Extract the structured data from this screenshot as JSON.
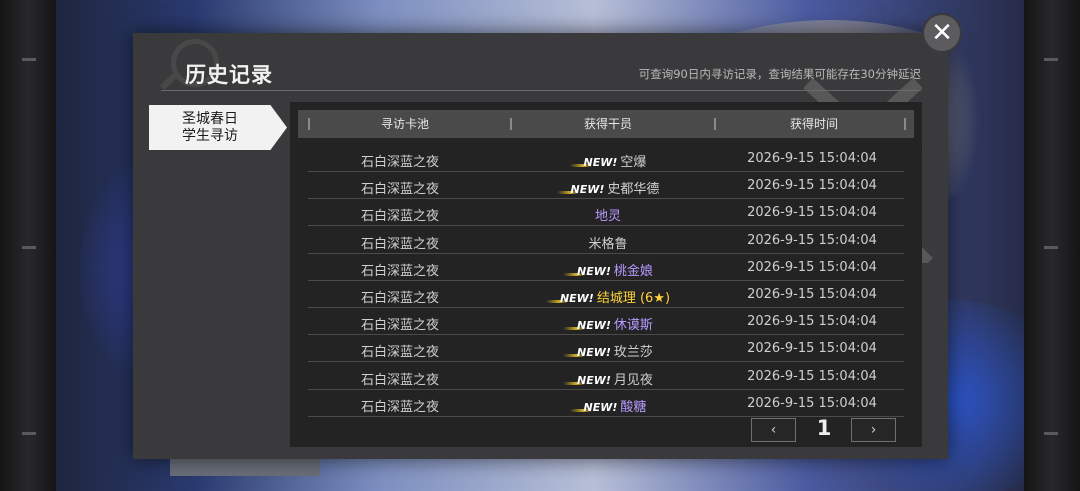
{
  "dialog": {
    "title": "历史记录",
    "notice": "可查询90日内寻访记录，查询结果可能存在30分钟延迟"
  },
  "pool_tab": {
    "line1": "圣城春日",
    "line2": "学生寻访"
  },
  "table": {
    "headers": [
      "寻访卡池",
      "获得干员",
      "获得时间"
    ],
    "rows": [
      {
        "pool": "石白深蓝之夜",
        "new": "NEW!",
        "operator": "空爆",
        "rarity": "gray",
        "time": "2026-9-15 15:04:04"
      },
      {
        "pool": "石白深蓝之夜",
        "new": "NEW!",
        "operator": "史都华德",
        "rarity": "gray",
        "time": "2026-9-15 15:04:04"
      },
      {
        "pool": "石白深蓝之夜",
        "new": "",
        "operator": "地灵",
        "rarity": "purple",
        "time": "2026-9-15 15:04:04"
      },
      {
        "pool": "石白深蓝之夜",
        "new": "",
        "operator": "米格鲁",
        "rarity": "gray",
        "time": "2026-9-15 15:04:04"
      },
      {
        "pool": "石白深蓝之夜",
        "new": "NEW!",
        "operator": "桃金娘",
        "rarity": "purple",
        "time": "2026-9-15 15:04:04"
      },
      {
        "pool": "石白深蓝之夜",
        "new": "NEW!",
        "operator": "结城理 (6★)",
        "rarity": "gold",
        "time": "2026-9-15 15:04:04"
      },
      {
        "pool": "石白深蓝之夜",
        "new": "NEW!",
        "operator": "休谟斯",
        "rarity": "purple",
        "time": "2026-9-15 15:04:04"
      },
      {
        "pool": "石白深蓝之夜",
        "new": "NEW!",
        "operator": "玫兰莎",
        "rarity": "gray",
        "time": "2026-9-15 15:04:04"
      },
      {
        "pool": "石白深蓝之夜",
        "new": "NEW!",
        "operator": "月见夜",
        "rarity": "gray",
        "time": "2026-9-15 15:04:04"
      },
      {
        "pool": "石白深蓝之夜",
        "new": "NEW!",
        "operator": "酸糖",
        "rarity": "purple",
        "time": "2026-9-15 15:04:04"
      }
    ]
  },
  "pagination": {
    "prev": "‹",
    "next": "›",
    "page": "1"
  },
  "close": "✕",
  "colors": {
    "purple": "#b89aff",
    "gold": "#ffd23a",
    "gray": "#cfcfcf"
  }
}
